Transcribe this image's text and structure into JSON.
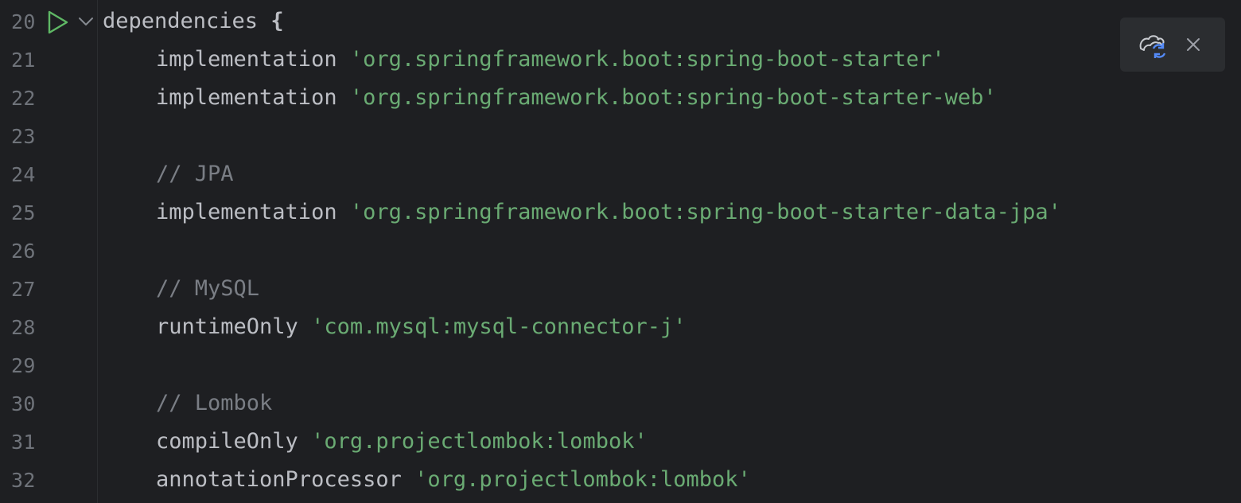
{
  "editor": {
    "lines": [
      {
        "num": "20",
        "tokens": [
          {
            "t": "dependencies ",
            "c": "kw"
          },
          {
            "t": "{",
            "c": "brace"
          }
        ]
      },
      {
        "num": "21",
        "indent": true,
        "tokens": [
          {
            "t": "implementation ",
            "c": "kw"
          },
          {
            "t": "'org.springframework.boot:spring-boot-starter'",
            "c": "str"
          }
        ]
      },
      {
        "num": "22",
        "indent": true,
        "tokens": [
          {
            "t": "implementation ",
            "c": "kw"
          },
          {
            "t": "'org.springframework.boot:spring-boot-starter-web'",
            "c": "str"
          }
        ]
      },
      {
        "num": "23",
        "tokens": []
      },
      {
        "num": "24",
        "indent": true,
        "tokens": [
          {
            "t": "// JPA",
            "c": "comment"
          }
        ]
      },
      {
        "num": "25",
        "indent": true,
        "tokens": [
          {
            "t": "implementation ",
            "c": "kw"
          },
          {
            "t": "'org.springframework.boot:spring-boot-starter-data-jpa'",
            "c": "str"
          }
        ]
      },
      {
        "num": "26",
        "tokens": []
      },
      {
        "num": "27",
        "indent": true,
        "tokens": [
          {
            "t": "// MySQL",
            "c": "comment"
          }
        ]
      },
      {
        "num": "28",
        "indent": true,
        "tokens": [
          {
            "t": "runtimeOnly ",
            "c": "kw"
          },
          {
            "t": "'com.mysql:mysql-connector-j'",
            "c": "str"
          }
        ]
      },
      {
        "num": "29",
        "tokens": []
      },
      {
        "num": "30",
        "indent": true,
        "tokens": [
          {
            "t": "// Lombok",
            "c": "comment"
          }
        ]
      },
      {
        "num": "31",
        "indent": true,
        "tokens": [
          {
            "t": "compileOnly ",
            "c": "kw"
          },
          {
            "t": "'org.projectlombok:lombok'",
            "c": "str"
          }
        ]
      },
      {
        "num": "32",
        "indent": true,
        "tokens": [
          {
            "t": "annotationProcessor ",
            "c": "kw"
          },
          {
            "t": "'org.projectlombok:lombok'",
            "c": "str"
          }
        ]
      }
    ]
  },
  "icons": {
    "run": "run-gutter-icon",
    "fold": "fold-chevron-icon",
    "sync": "gradle-sync-icon",
    "close": "close-icon"
  },
  "colors": {
    "background": "#1e1f22",
    "string": "#6aab73",
    "comment": "#7a7e85",
    "text": "#bcbec4",
    "line_number": "#6f737a",
    "run_icon": "#5fb865",
    "sync_accent": "#548af7"
  }
}
